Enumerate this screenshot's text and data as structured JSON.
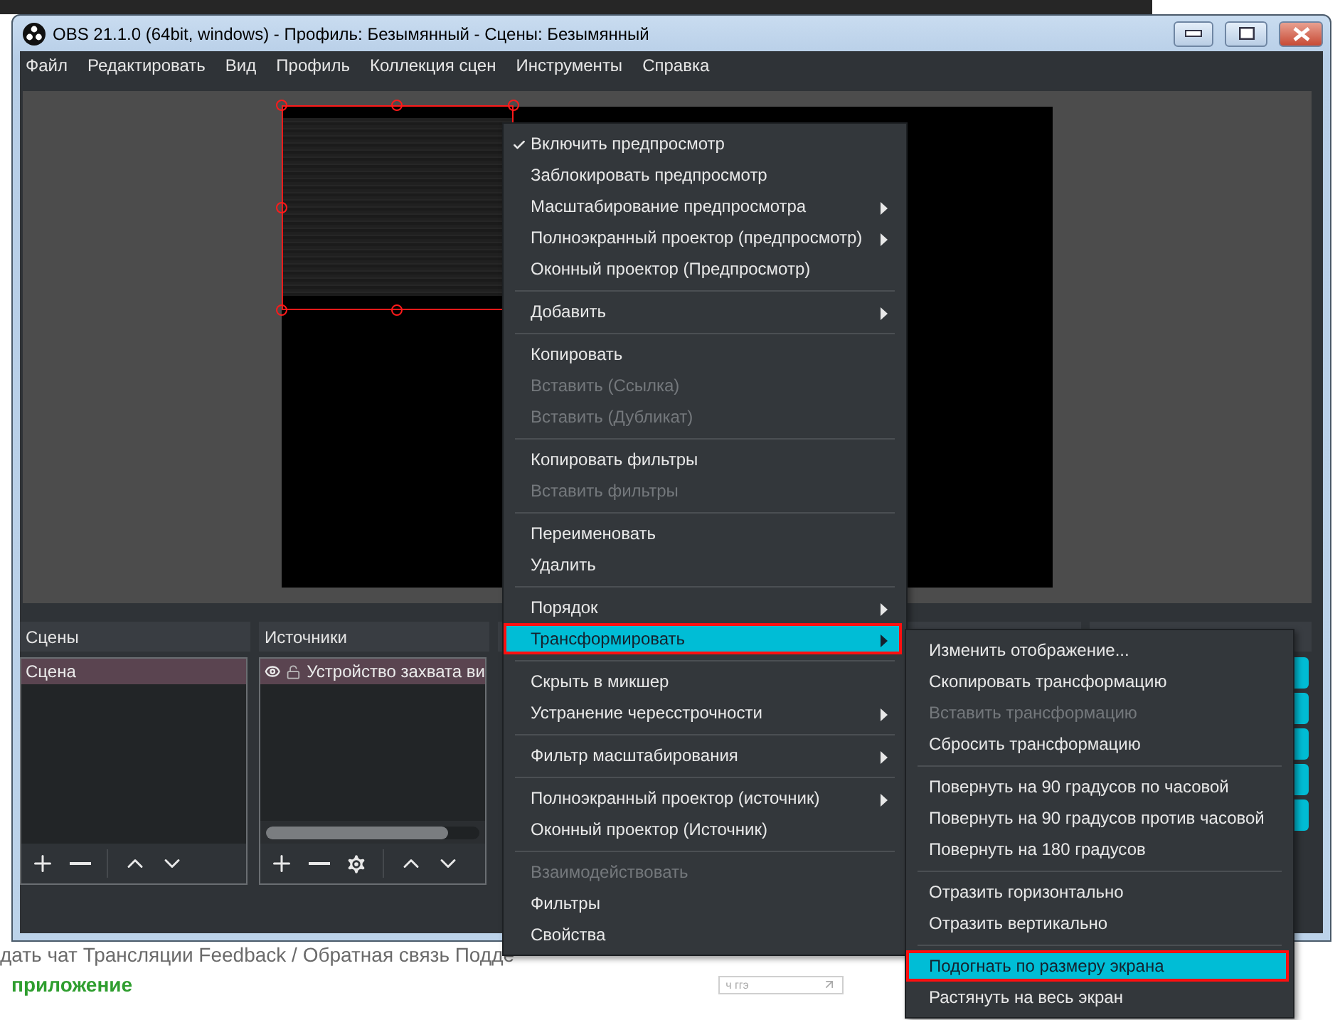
{
  "window": {
    "title": "OBS 21.1.0 (64bit, windows) - Профиль: Безымянный - Сцены: Безымянный"
  },
  "menu_bar": [
    "Файл",
    "Редактировать",
    "Вид",
    "Профиль",
    "Коллекция сцен",
    "Инструменты",
    "Справка"
  ],
  "preview": {
    "source_selected": true
  },
  "scenes": {
    "title": "Сцены",
    "items": [
      {
        "label": "Сцена",
        "selected": true
      }
    ]
  },
  "sources": {
    "title": "Источники",
    "items": [
      {
        "label": "Устройство захвата ви",
        "visible": true,
        "locked": false,
        "selected": true
      }
    ]
  },
  "context_menu": {
    "sections": [
      {
        "items": [
          {
            "label": "Включить предпросмотр",
            "checked": true,
            "disabled": false,
            "has_submenu": false,
            "selected": false
          },
          {
            "label": "Заблокировать предпросмотр",
            "checked": false,
            "disabled": false,
            "has_submenu": false,
            "selected": false
          },
          {
            "label": "Масштабирование предпросмотра",
            "checked": false,
            "disabled": false,
            "has_submenu": true,
            "selected": false
          },
          {
            "label": "Полноэкранный проектор (предпросмотр)",
            "checked": false,
            "disabled": false,
            "has_submenu": true,
            "selected": false
          },
          {
            "label": "Оконный проектор (Предпросмотр)",
            "checked": false,
            "disabled": false,
            "has_submenu": false,
            "selected": false
          }
        ]
      },
      {
        "items": [
          {
            "label": "Добавить",
            "checked": false,
            "disabled": false,
            "has_submenu": true,
            "selected": false
          }
        ]
      },
      {
        "items": [
          {
            "label": "Копировать",
            "checked": false,
            "disabled": false,
            "has_submenu": false,
            "selected": false
          },
          {
            "label": "Вставить (Ссылка)",
            "checked": false,
            "disabled": true,
            "has_submenu": false,
            "selected": false
          },
          {
            "label": "Вставить (Дубликат)",
            "checked": false,
            "disabled": true,
            "has_submenu": false,
            "selected": false
          }
        ]
      },
      {
        "items": [
          {
            "label": "Копировать фильтры",
            "checked": false,
            "disabled": false,
            "has_submenu": false,
            "selected": false
          },
          {
            "label": "Вставить фильтры",
            "checked": false,
            "disabled": true,
            "has_submenu": false,
            "selected": false
          }
        ]
      },
      {
        "items": [
          {
            "label": "Переименовать",
            "checked": false,
            "disabled": false,
            "has_submenu": false,
            "selected": false
          },
          {
            "label": "Удалить",
            "checked": false,
            "disabled": false,
            "has_submenu": false,
            "selected": false
          }
        ]
      },
      {
        "items": [
          {
            "label": "Порядок",
            "checked": false,
            "disabled": false,
            "has_submenu": true,
            "selected": false
          },
          {
            "label": "Трансформировать",
            "checked": false,
            "disabled": false,
            "has_submenu": true,
            "selected": true
          }
        ]
      },
      {
        "items": [
          {
            "label": "Скрыть в микшер",
            "checked": false,
            "disabled": false,
            "has_submenu": false,
            "selected": false
          },
          {
            "label": "Устранение чересстрочности",
            "checked": false,
            "disabled": false,
            "has_submenu": true,
            "selected": false
          }
        ]
      },
      {
        "items": [
          {
            "label": "Фильтр масштабирования",
            "checked": false,
            "disabled": false,
            "has_submenu": true,
            "selected": false
          }
        ]
      },
      {
        "items": [
          {
            "label": "Полноэкранный проектор (источник)",
            "checked": false,
            "disabled": false,
            "has_submenu": true,
            "selected": false
          },
          {
            "label": "Оконный проектор (Источник)",
            "checked": false,
            "disabled": false,
            "has_submenu": false,
            "selected": false
          }
        ]
      },
      {
        "items": [
          {
            "label": "Взаимодействовать",
            "checked": false,
            "disabled": true,
            "has_submenu": false,
            "selected": false
          },
          {
            "label": "Фильтры",
            "checked": false,
            "disabled": false,
            "has_submenu": false,
            "selected": false
          },
          {
            "label": "Свойства",
            "checked": false,
            "disabled": false,
            "has_submenu": false,
            "selected": false
          }
        ]
      }
    ]
  },
  "submenu": {
    "sections": [
      {
        "items": [
          {
            "label": "Изменить отображение...",
            "checked": false,
            "disabled": false,
            "has_submenu": false,
            "selected": false
          },
          {
            "label": "Скопировать трансформацию",
            "checked": false,
            "disabled": false,
            "has_submenu": false,
            "selected": false
          },
          {
            "label": "Вставить трансформацию",
            "checked": false,
            "disabled": true,
            "has_submenu": false,
            "selected": false
          },
          {
            "label": "Сбросить трансформацию",
            "checked": false,
            "disabled": false,
            "has_submenu": false,
            "selected": false
          }
        ]
      },
      {
        "items": [
          {
            "label": "Повернуть на 90 градусов по часовой",
            "checked": false,
            "disabled": false,
            "has_submenu": false,
            "selected": false
          },
          {
            "label": "Повернуть на 90 градусов против часовой",
            "checked": false,
            "disabled": false,
            "has_submenu": false,
            "selected": false
          },
          {
            "label": "Повернуть на 180 градусов",
            "checked": false,
            "disabled": false,
            "has_submenu": false,
            "selected": false
          }
        ]
      },
      {
        "items": [
          {
            "label": "Отразить горизонтально",
            "checked": false,
            "disabled": false,
            "has_submenu": false,
            "selected": false
          },
          {
            "label": "Отразить вертикально",
            "checked": false,
            "disabled": false,
            "has_submenu": false,
            "selected": false
          }
        ]
      },
      {
        "items": [
          {
            "label": "Подогнать по размеру экрана",
            "checked": false,
            "disabled": false,
            "has_submenu": false,
            "selected": true
          },
          {
            "label": "Растянуть на весь экран",
            "checked": false,
            "disabled": false,
            "has_submenu": false,
            "selected": false
          }
        ]
      }
    ]
  },
  "page_behind": {
    "line_1": "дать чат Трансляции Feedback / Обратная связь Подде",
    "line_2": "приложение",
    "field_text": "ч ггэ"
  }
}
